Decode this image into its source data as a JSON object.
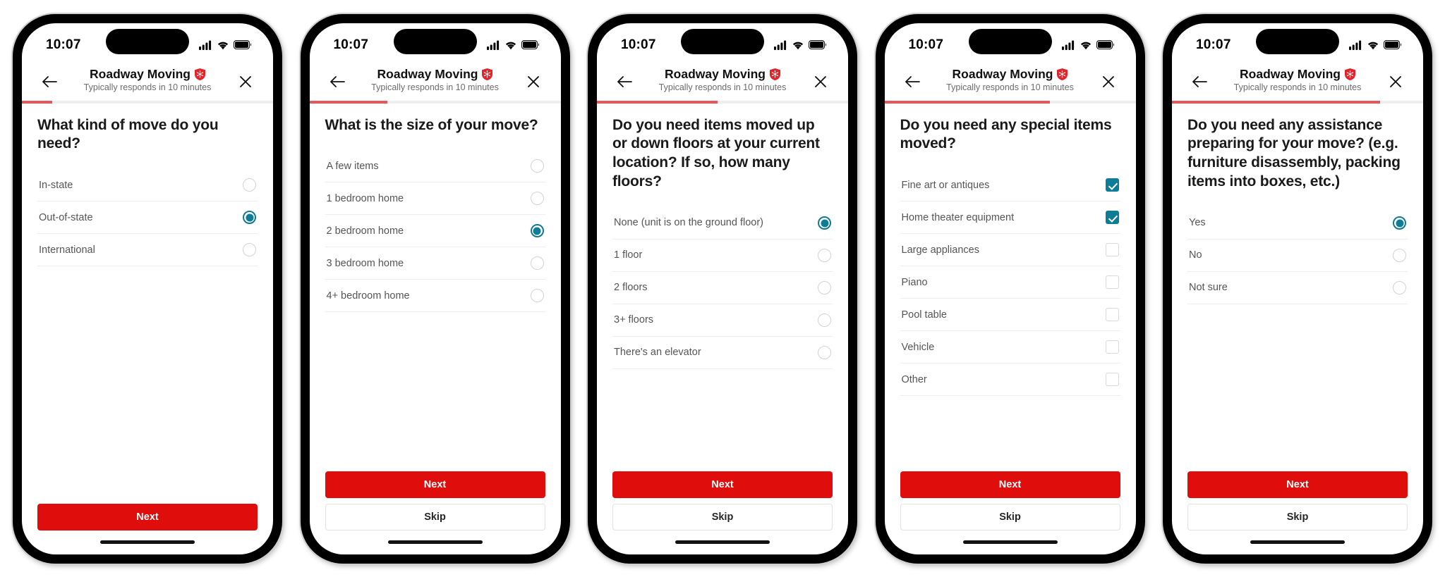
{
  "brand": {
    "accent_red": "#e00d0d",
    "progress_red": "#e8555a",
    "select_teal": "#0d7c96",
    "badge_red": "#e2232a"
  },
  "status_bar": {
    "time": "10:07",
    "cellular_icon": "cellular-signal-icon",
    "wifi_icon": "wifi-icon",
    "battery_icon": "battery-icon",
    "dynamic_island": "dynamic-island"
  },
  "header": {
    "back_icon": "back-arrow-icon",
    "close_icon": "close-x-icon",
    "title": "Roadway Moving",
    "verified_icon": "verified-shield-icon",
    "subtitle": "Typically responds in 10 minutes"
  },
  "buttons": {
    "next": "Next",
    "skip": "Skip"
  },
  "screens": [
    {
      "id": "move-kind",
      "progress_percent": 12,
      "question": "What kind of move do you need?",
      "control_type": "radio",
      "has_skip": false,
      "options": [
        {
          "label": "In-state",
          "selected": false
        },
        {
          "label": "Out-of-state",
          "selected": true
        },
        {
          "label": "International",
          "selected": false
        }
      ]
    },
    {
      "id": "move-size",
      "progress_percent": 31,
      "question": "What is the size of your move?",
      "control_type": "radio",
      "has_skip": true,
      "options": [
        {
          "label": "A few items",
          "selected": false
        },
        {
          "label": "1 bedroom home",
          "selected": false
        },
        {
          "label": "2 bedroom home",
          "selected": true
        },
        {
          "label": "3 bedroom home",
          "selected": false
        },
        {
          "label": "4+ bedroom home",
          "selected": false
        }
      ]
    },
    {
      "id": "floors",
      "progress_percent": 48,
      "question": "Do you need items moved up or down floors at your current location?  If so, how many floors?",
      "control_type": "radio",
      "has_skip": true,
      "options": [
        {
          "label": "None (unit is on the ground floor)",
          "selected": true
        },
        {
          "label": "1 floor",
          "selected": false
        },
        {
          "label": "2 floors",
          "selected": false
        },
        {
          "label": "3+ floors",
          "selected": false
        },
        {
          "label": "There's an elevator",
          "selected": false
        }
      ]
    },
    {
      "id": "special-items",
      "progress_percent": 66,
      "question": "Do you need any special items moved?",
      "control_type": "checkbox",
      "has_skip": true,
      "options": [
        {
          "label": "Fine art or antiques",
          "selected": true
        },
        {
          "label": "Home theater equipment",
          "selected": true
        },
        {
          "label": "Large appliances",
          "selected": false
        },
        {
          "label": "Piano",
          "selected": false
        },
        {
          "label": "Pool table",
          "selected": false
        },
        {
          "label": "Vehicle",
          "selected": false
        },
        {
          "label": "Other",
          "selected": false
        }
      ]
    },
    {
      "id": "prep-assistance",
      "progress_percent": 83,
      "question": "Do you need any assistance preparing for your move? (e.g. furniture disassembly, packing items into boxes, etc.)",
      "control_type": "radio",
      "has_skip": true,
      "options": [
        {
          "label": "Yes",
          "selected": true
        },
        {
          "label": "No",
          "selected": false
        },
        {
          "label": "Not sure",
          "selected": false
        }
      ]
    }
  ]
}
